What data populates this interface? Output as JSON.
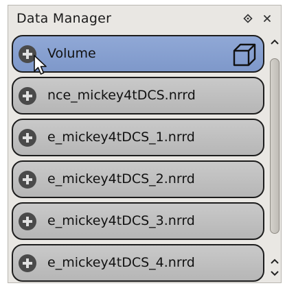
{
  "window": {
    "title": "Data Manager",
    "float_icon": "diamond-float-icon",
    "close_icon": "close-icon"
  },
  "items": [
    {
      "label": "Volume",
      "selected": true,
      "icon": "plus-circle-icon",
      "type_icon": "cube-volume-icon"
    },
    {
      "label": "nce_mickey4tDCS.nrrd",
      "selected": false,
      "icon": "plus-circle-icon"
    },
    {
      "label": "e_mickey4tDCS_1.nrrd",
      "selected": false,
      "icon": "plus-circle-icon"
    },
    {
      "label": "e_mickey4tDCS_2.nrrd",
      "selected": false,
      "icon": "plus-circle-icon"
    },
    {
      "label": "e_mickey4tDCS_3.nrrd",
      "selected": false,
      "icon": "plus-circle-icon"
    },
    {
      "label": "e_mickey4tDCS_4.nrrd",
      "selected": false,
      "icon": "plus-circle-icon"
    }
  ],
  "colors": {
    "selected_item": "#869fcf",
    "item": "#bdbdbd",
    "panel": "#e9e7e3",
    "border": "#1c1c1c"
  }
}
